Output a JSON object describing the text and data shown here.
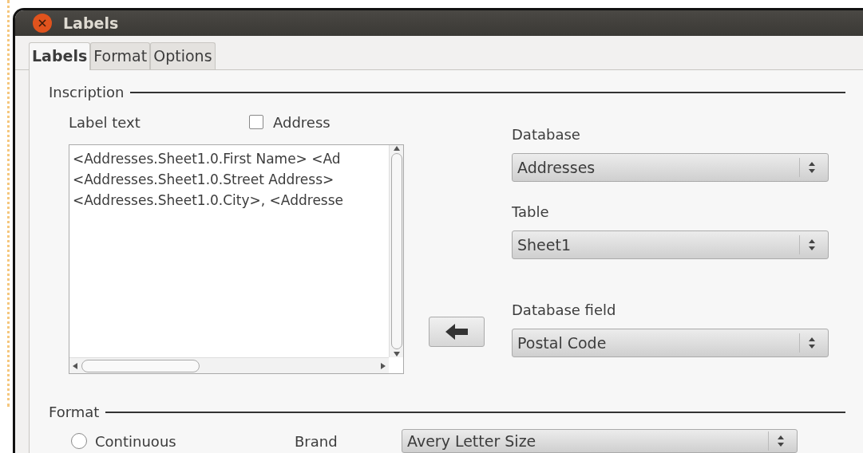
{
  "window": {
    "title": "Labels"
  },
  "tabs": [
    {
      "label": "Labels",
      "selected": true
    },
    {
      "label": "Format",
      "selected": false
    },
    {
      "label": "Options",
      "selected": false
    }
  ],
  "inscription": {
    "heading": "Inscription",
    "label_text_label": "Label text",
    "address_checkbox": {
      "label": "Address",
      "checked": false
    },
    "label_text_lines": [
      "<Addresses.Sheet1.0.First Name> <Ad",
      "<Addresses.Sheet1.0.Street Address>",
      "<Addresses.Sheet1.0.City>, <Addresse"
    ],
    "database": {
      "label": "Database",
      "value": "Addresses"
    },
    "table": {
      "label": "Table",
      "value": "Sheet1"
    },
    "database_field": {
      "label": "Database field",
      "value": "Postal Code"
    }
  },
  "format": {
    "heading": "Format",
    "continuous": {
      "label": "Continuous",
      "selected": false
    },
    "brand": {
      "label": "Brand",
      "value": "Avery Letter Size"
    }
  }
}
